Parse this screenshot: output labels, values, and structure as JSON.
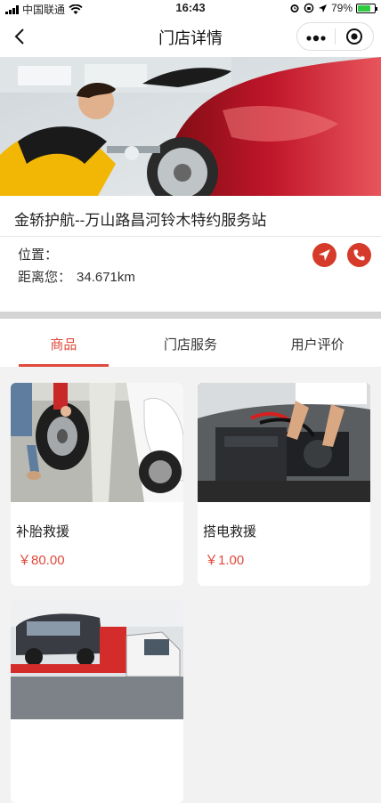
{
  "statusbar": {
    "carrier": "中国联通",
    "time": "16:43",
    "battery": "79%",
    "battery_level": 0.79
  },
  "nav": {
    "title": "门店详情",
    "back_icon": "chevron-left-icon",
    "more_icon": "more-dots-icon",
    "close_icon": "target-icon"
  },
  "store": {
    "name": "金轿护航--万山路昌河铃木特约服务站",
    "location_label": "位置：",
    "distance_label": "距离您：",
    "distance": "34.671km",
    "accent_color": "#d63a2a"
  },
  "tabs": [
    {
      "label": "商品",
      "active": true
    },
    {
      "label": "门店服务",
      "active": false
    },
    {
      "label": "用户评价",
      "active": false
    }
  ],
  "products": [
    {
      "name": "补胎救援",
      "price": "￥80.00"
    },
    {
      "name": "搭电救援",
      "price": "￥1.00"
    },
    {
      "name": "",
      "price": ""
    }
  ]
}
